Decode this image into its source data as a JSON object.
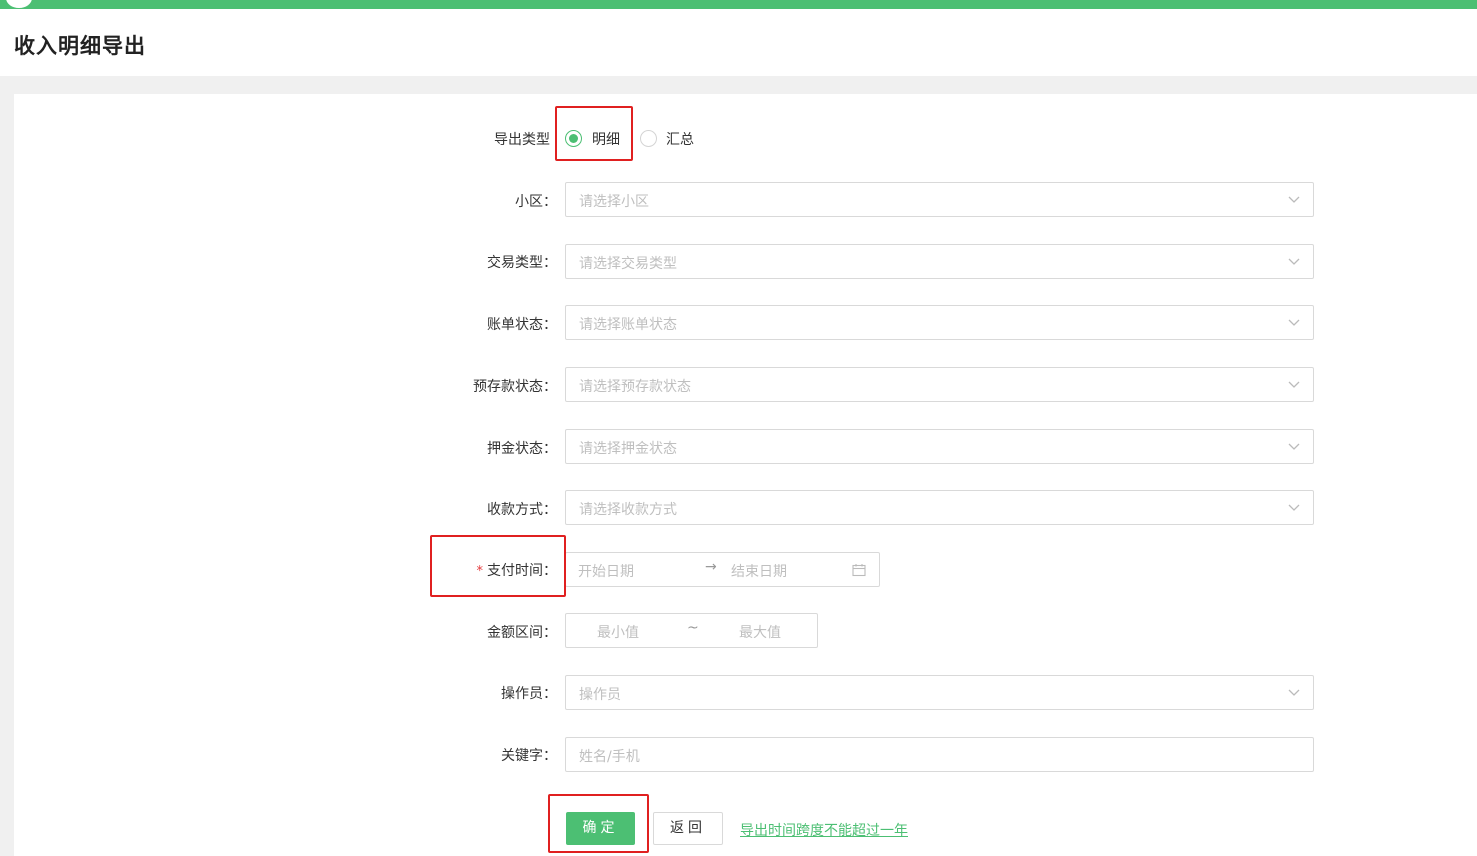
{
  "page": {
    "title": "收入明细导出"
  },
  "colors": {
    "accent": "#4cbf73",
    "highlight": "#e02020",
    "placeholder": "#bfbfbf"
  },
  "export_type": {
    "label": "导出类型",
    "options": [
      {
        "label": "明细",
        "checked": true
      },
      {
        "label": "汇总",
        "checked": false
      }
    ]
  },
  "fields": {
    "community": {
      "label": "小区：",
      "placeholder": "请选择小区"
    },
    "trade_type": {
      "label": "交易类型：",
      "placeholder": "请选择交易类型"
    },
    "bill_status": {
      "label": "账单状态：",
      "placeholder": "请选择账单状态"
    },
    "deposit_status": {
      "label": "预存款状态：",
      "placeholder": "请选择预存款状态"
    },
    "pledge_status": {
      "label": "押金状态：",
      "placeholder": "请选择押金状态"
    },
    "pay_method": {
      "label": "收款方式：",
      "placeholder": "请选择收款方式"
    },
    "pay_time": {
      "label": "支付时间：",
      "required_mark": "*",
      "start_placeholder": "开始日期",
      "separator": "→",
      "end_placeholder": "结束日期"
    },
    "amount_range": {
      "label": "金额区间：",
      "min_placeholder": "最小值",
      "separator": "~",
      "max_placeholder": "最大值"
    },
    "operator": {
      "label": "操作员：",
      "placeholder": "操作员"
    },
    "keyword": {
      "label": "关键字：",
      "placeholder": "姓名/手机"
    }
  },
  "actions": {
    "confirm_label": "确定",
    "back_label": "返回",
    "note_link": "导出时间跨度不能超过一年"
  },
  "icons": {
    "dropdown": "chevron-down-icon",
    "calendar": "calendar-icon"
  }
}
